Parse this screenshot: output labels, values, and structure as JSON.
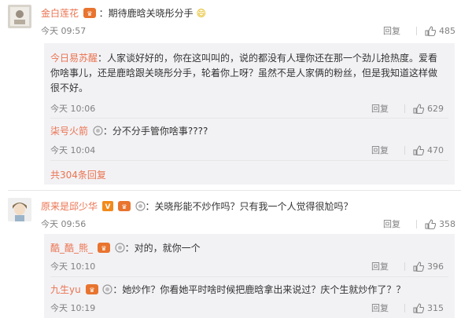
{
  "comments": [
    {
      "name": "金白莲花",
      "text": "：期待鹿晗关晓彤分手",
      "emoji": "😄",
      "time": "今天 09:57",
      "reply_label": "回复",
      "likes": "485",
      "replies": [
        {
          "name": "今日易苏醒",
          "text_lines": [
            "：人家谈好好的，你在这叫叫的，说的都没有人理你还在那一个劲儿抢热度。爱看",
            "你啥事儿，还是鹿晗跟关晓彤分手，轮着你上呀？虽然不是人家俩的粉丝，但是我知道这样做",
            "很不好。"
          ],
          "time": "今天 10:06",
          "reply_label": "回复",
          "likes": "629"
        },
        {
          "name": "柒号火箭",
          "text": "：分不分手管你啥事????",
          "time": "今天 10:04",
          "reply_label": "回复",
          "likes": "470"
        }
      ],
      "more_replies": "共304条回复"
    },
    {
      "name": "原来是邱少华",
      "text": "：关晓彤能不炒作吗？只有我一个人觉得很尬吗？",
      "time": "今天 09:56",
      "reply_label": "回复",
      "likes": "358",
      "vip_badge": "V",
      "replies": [
        {
          "name": "酷_酷_熊_",
          "text": "：对的，就你一个",
          "time": "今天 10:10",
          "reply_label": "回复",
          "likes": "396"
        },
        {
          "name": "九生yu",
          "text": "：她炒作？你看她平时啥时候把鹿晗拿出来说过？庆个生就炒作了？？",
          "time": "今天 10:19",
          "reply_label": "回复",
          "likes": "315"
        }
      ]
    }
  ],
  "colors": {
    "name": "#eb7350",
    "meta": "#808080",
    "subbg": "#f2f2f5"
  }
}
